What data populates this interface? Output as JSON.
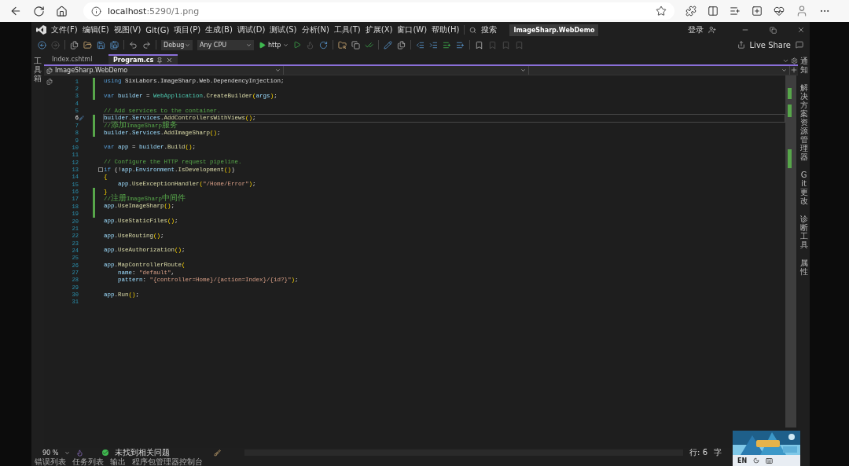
{
  "browser": {
    "url_host": "localhost",
    "url_path": ":5290/1.png"
  },
  "window": {
    "menus": [
      "文件(F)",
      "编辑(E)",
      "视图(V)",
      "Git(G)",
      "项目(P)",
      "生成(B)",
      "调试(D)",
      "测试(S)",
      "分析(N)",
      "工具(T)",
      "扩展(X)",
      "窗口(W)",
      "帮助(H)"
    ],
    "search": "搜索",
    "solution": "ImageSharp.WebDemo",
    "sign_in": "登录"
  },
  "toolbar": {
    "configuration": "Debug",
    "platform": "Any CPU",
    "run": "http",
    "live_share": "Live Share"
  },
  "left_strip": [
    "工具箱"
  ],
  "right_strip": [
    "通知",
    "解决方案资源管理器",
    "Git 更改",
    "诊断工具",
    "属性"
  ],
  "tabs": [
    {
      "label": "Index.cshtml",
      "selected": false
    },
    {
      "label": "Program.cs",
      "selected": true
    }
  ],
  "navbar": {
    "project": "ImageSharp.WebDemo"
  },
  "code": [
    {
      "number": "1",
      "changed": true,
      "tokens": [
        {
          "kind": "kw",
          "text": "using"
        },
        {
          "kind": "plain",
          "text": " SixLabors.ImageSharp.Web.DependencyInjection;"
        }
      ]
    },
    {
      "number": "2",
      "changed": true
    },
    {
      "number": "3",
      "changed": true,
      "tokens": [
        {
          "kind": "kw",
          "text": "var"
        },
        {
          "kind": "var",
          "text": " builder"
        },
        {
          "kind": "plain",
          "text": " = "
        },
        {
          "kind": "type",
          "text": "WebApplication"
        },
        {
          "kind": "plain",
          "text": "."
        },
        {
          "kind": "method",
          "text": "CreateBuilder"
        },
        {
          "kind": "paren",
          "text": "("
        },
        {
          "kind": "var",
          "text": "args"
        },
        {
          "kind": "paren",
          "text": ")"
        },
        {
          "kind": "plain",
          "text": ";"
        }
      ]
    },
    {
      "number": "4",
      "changed": false
    },
    {
      "number": "5",
      "changed": false,
      "tokens": [
        {
          "kind": "comment",
          "text": "// Add services to the container."
        }
      ]
    },
    {
      "number": "6",
      "changed": true,
      "current": true,
      "tokens": [
        {
          "kind": "var",
          "text": "builder"
        },
        {
          "kind": "plain",
          "text": "."
        },
        {
          "kind": "var",
          "text": "Services"
        },
        {
          "kind": "plain",
          "text": "."
        },
        {
          "kind": "method",
          "text": "AddControllersWithViews"
        },
        {
          "kind": "paren",
          "text": "()"
        },
        {
          "kind": "plain",
          "text": ";"
        }
      ]
    },
    {
      "number": "7",
      "changed": true,
      "tokens": [
        {
          "kind": "comment",
          "text": "//添加ImageSharp服务"
        }
      ]
    },
    {
      "number": "8",
      "changed": true,
      "tokens": [
        {
          "kind": "var",
          "text": "builder"
        },
        {
          "kind": "plain",
          "text": "."
        },
        {
          "kind": "var",
          "text": "Services"
        },
        {
          "kind": "plain",
          "text": "."
        },
        {
          "kind": "method",
          "text": "AddImageSharp"
        },
        {
          "kind": "paren",
          "text": "()"
        },
        {
          "kind": "plain",
          "text": ";"
        }
      ]
    },
    {
      "number": "9",
      "changed": false
    },
    {
      "number": "10",
      "changed": false,
      "tokens": [
        {
          "kind": "kw",
          "text": "var"
        },
        {
          "kind": "var",
          "text": " app"
        },
        {
          "kind": "plain",
          "text": " = "
        },
        {
          "kind": "var",
          "text": "builder"
        },
        {
          "kind": "plain",
          "text": "."
        },
        {
          "kind": "method",
          "text": "Build"
        },
        {
          "kind": "paren",
          "text": "()"
        },
        {
          "kind": "plain",
          "text": ";"
        }
      ]
    },
    {
      "number": "11",
      "changed": false
    },
    {
      "number": "12",
      "changed": false,
      "tokens": [
        {
          "kind": "comment",
          "text": "// Configure the HTTP request pipeline."
        }
      ]
    },
    {
      "number": "13",
      "changed": false,
      "fold": true,
      "tokens": [
        {
          "kind": "kw",
          "text": "if"
        },
        {
          "kind": "plain",
          "text": " (!"
        },
        {
          "kind": "var",
          "text": "app"
        },
        {
          "kind": "plain",
          "text": "."
        },
        {
          "kind": "var",
          "text": "Environment"
        },
        {
          "kind": "plain",
          "text": "."
        },
        {
          "kind": "method",
          "text": "IsDevelopment"
        },
        {
          "kind": "paren",
          "text": "()"
        },
        {
          "kind": "plain",
          "text": ")"
        }
      ]
    },
    {
      "number": "14",
      "changed": false,
      "tokens": [
        {
          "kind": "paren",
          "text": "{"
        }
      ]
    },
    {
      "number": "15",
      "changed": false,
      "tokens": [
        {
          "kind": "var",
          "text": "    app"
        },
        {
          "kind": "plain",
          "text": "."
        },
        {
          "kind": "method",
          "text": "UseExceptionHandler"
        },
        {
          "kind": "paren",
          "text": "("
        },
        {
          "kind": "string",
          "text": "\"/Home/Error\""
        },
        {
          "kind": "paren",
          "text": ")"
        },
        {
          "kind": "plain",
          "text": ";"
        }
      ]
    },
    {
      "number": "16",
      "changed": true,
      "tokens": [
        {
          "kind": "paren",
          "text": "}"
        }
      ]
    },
    {
      "number": "17",
      "changed": true,
      "tokens": [
        {
          "kind": "comment",
          "text": "//注册ImageSharp中间件"
        }
      ]
    },
    {
      "number": "18",
      "changed": true,
      "tokens": [
        {
          "kind": "var",
          "text": "app"
        },
        {
          "kind": "plain",
          "text": "."
        },
        {
          "kind": "method",
          "text": "UseImageSharp"
        },
        {
          "kind": "paren",
          "text": "()"
        },
        {
          "kind": "plain",
          "text": ";"
        }
      ]
    },
    {
      "number": "19",
      "changed": true
    },
    {
      "number": "20",
      "changed": false,
      "tokens": [
        {
          "kind": "var",
          "text": "app"
        },
        {
          "kind": "plain",
          "text": "."
        },
        {
          "kind": "method",
          "text": "UseStaticFiles"
        },
        {
          "kind": "paren",
          "text": "()"
        },
        {
          "kind": "plain",
          "text": ";"
        }
      ]
    },
    {
      "number": "21",
      "changed": false
    },
    {
      "number": "22",
      "changed": false,
      "tokens": [
        {
          "kind": "var",
          "text": "app"
        },
        {
          "kind": "plain",
          "text": "."
        },
        {
          "kind": "method",
          "text": "UseRouting"
        },
        {
          "kind": "paren",
          "text": "()"
        },
        {
          "kind": "plain",
          "text": ";"
        }
      ]
    },
    {
      "number": "23",
      "changed": false
    },
    {
      "number": "24",
      "changed": false,
      "tokens": [
        {
          "kind": "var",
          "text": "app"
        },
        {
          "kind": "plain",
          "text": "."
        },
        {
          "kind": "method",
          "text": "UseAuthorization"
        },
        {
          "kind": "paren",
          "text": "()"
        },
        {
          "kind": "plain",
          "text": ";"
        }
      ]
    },
    {
      "number": "25",
      "changed": false
    },
    {
      "number": "26",
      "changed": false,
      "tokens": [
        {
          "kind": "var",
          "text": "app"
        },
        {
          "kind": "plain",
          "text": "."
        },
        {
          "kind": "method",
          "text": "MapControllerRoute"
        },
        {
          "kind": "paren",
          "text": "("
        }
      ]
    },
    {
      "number": "27",
      "changed": false,
      "tokens": [
        {
          "kind": "var",
          "text": "    name"
        },
        {
          "kind": "plain",
          "text": ": "
        },
        {
          "kind": "string",
          "text": "\"default\""
        },
        {
          "kind": "plain",
          "text": ","
        }
      ]
    },
    {
      "number": "28",
      "changed": false,
      "tokens": [
        {
          "kind": "var",
          "text": "    pattern"
        },
        {
          "kind": "plain",
          "text": ": "
        },
        {
          "kind": "string",
          "text": "\"{controller=Home}/{action=Index}/{id?}\""
        },
        {
          "kind": "paren",
          "text": ")"
        },
        {
          "kind": "plain",
          "text": ";"
        }
      ]
    },
    {
      "number": "29",
      "changed": false
    },
    {
      "number": "30",
      "changed": false,
      "tokens": [
        {
          "kind": "var",
          "text": "app"
        },
        {
          "kind": "plain",
          "text": "."
        },
        {
          "kind": "method",
          "text": "Run"
        },
        {
          "kind": "paren",
          "text": "()"
        },
        {
          "kind": "plain",
          "text": ";"
        }
      ]
    },
    {
      "number": "31",
      "changed": false
    }
  ],
  "status_bar": {
    "zoom": "90 %",
    "issues": "未找到相关问题",
    "line": "行: 6",
    "column": "字"
  },
  "bottom_tabs": [
    "错误列表",
    "任务列表",
    "输出",
    "程序包管理器控制台"
  ],
  "overlay": {
    "language": "EN"
  }
}
